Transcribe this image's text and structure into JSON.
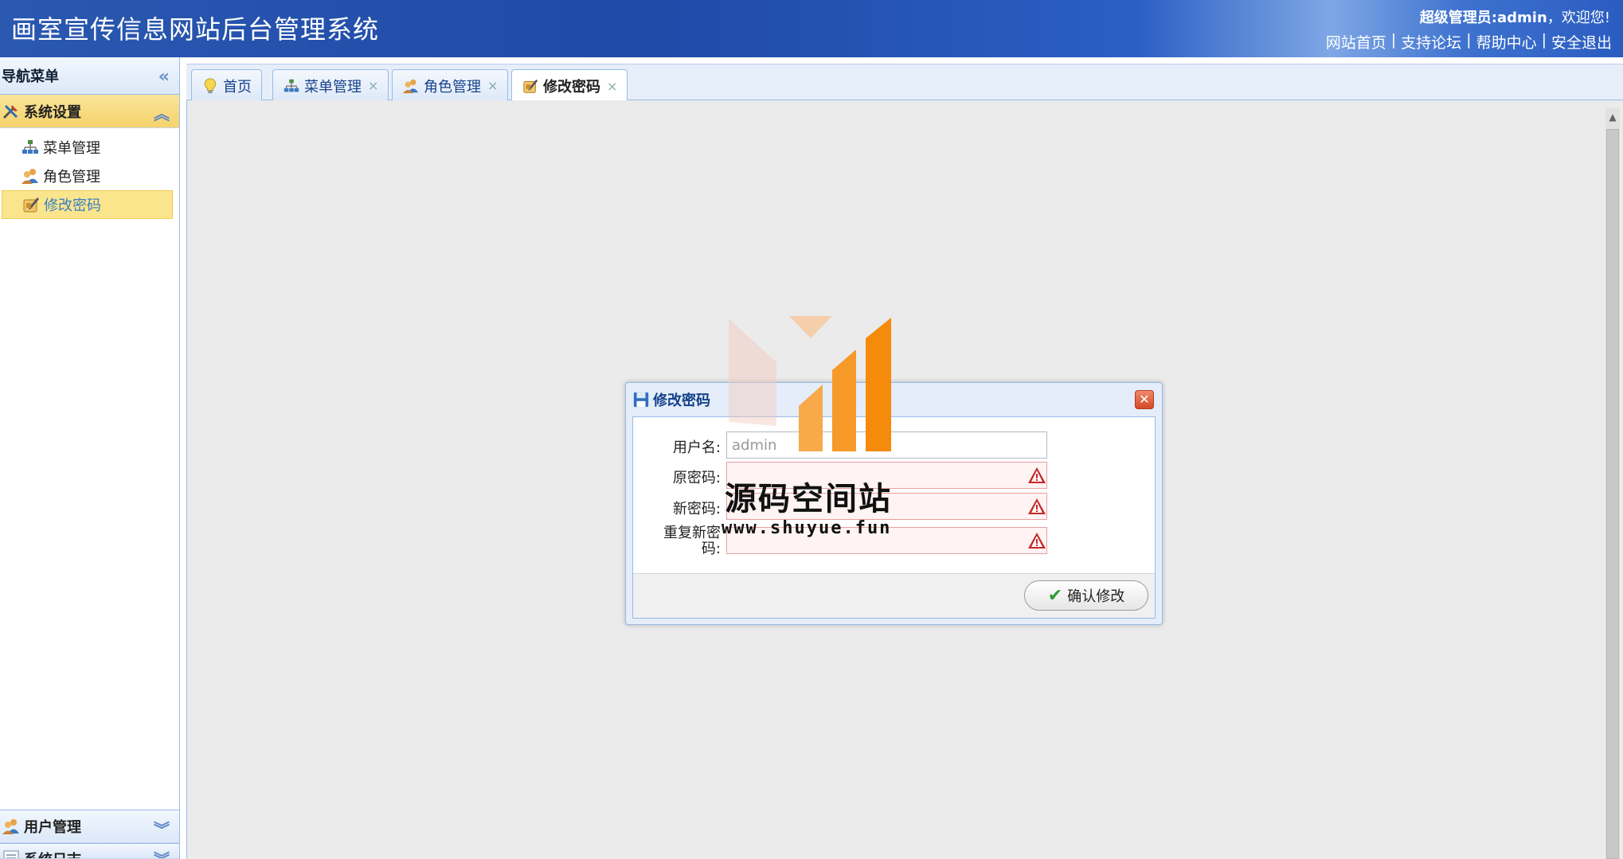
{
  "header": {
    "title": "画室宣传信息网站后台管理系统",
    "welcome_role": "超级管理员:admin",
    "welcome_suffix": "，欢迎您!",
    "links": [
      "网站首页",
      "支持论坛",
      "帮助中心",
      "安全退出"
    ],
    "link_separator": "|"
  },
  "sidebar": {
    "title": "导航菜单",
    "groups": [
      {
        "label": "系统设置",
        "expanded": true,
        "items": [
          {
            "label": "菜单管理",
            "icon": "org-chart-icon"
          },
          {
            "label": "角色管理",
            "icon": "users-icon"
          },
          {
            "label": "修改密码",
            "icon": "edit-password-icon",
            "selected": true
          }
        ]
      },
      {
        "label": "用户管理",
        "expanded": false
      },
      {
        "label": "系统日志",
        "expanded": false
      }
    ]
  },
  "tabs": [
    {
      "label": "首页",
      "icon": "lightbulb-icon",
      "closable": false
    },
    {
      "label": "菜单管理",
      "icon": "org-chart-icon",
      "closable": true
    },
    {
      "label": "角色管理",
      "icon": "users-icon",
      "closable": true
    },
    {
      "label": "修改密码",
      "icon": "edit-password-icon",
      "closable": true,
      "active": true
    }
  ],
  "tab_close_glyph": "×",
  "dialog": {
    "title": "修改密码",
    "close_glyph": "✕",
    "fields": [
      {
        "label": "用户名:",
        "value": "admin",
        "placeholder": ""
      },
      {
        "label": "原密码:",
        "value": "",
        "invalid": true
      },
      {
        "label": "新密码:",
        "value": "",
        "invalid": true
      },
      {
        "label": "重复新密码:",
        "value": "",
        "invalid": true
      }
    ],
    "confirm_label": "确认修改",
    "confirm_glyph": "✔"
  },
  "watermark": {
    "text": "源码空间站",
    "url": "www.shuyue.fun"
  },
  "colors": {
    "header_blue": "#2a58b0",
    "active_group": "#f5d36c",
    "border_blue": "#99bbe8",
    "logo_orange": "#f58a0b",
    "warn_red": "#c62828"
  }
}
